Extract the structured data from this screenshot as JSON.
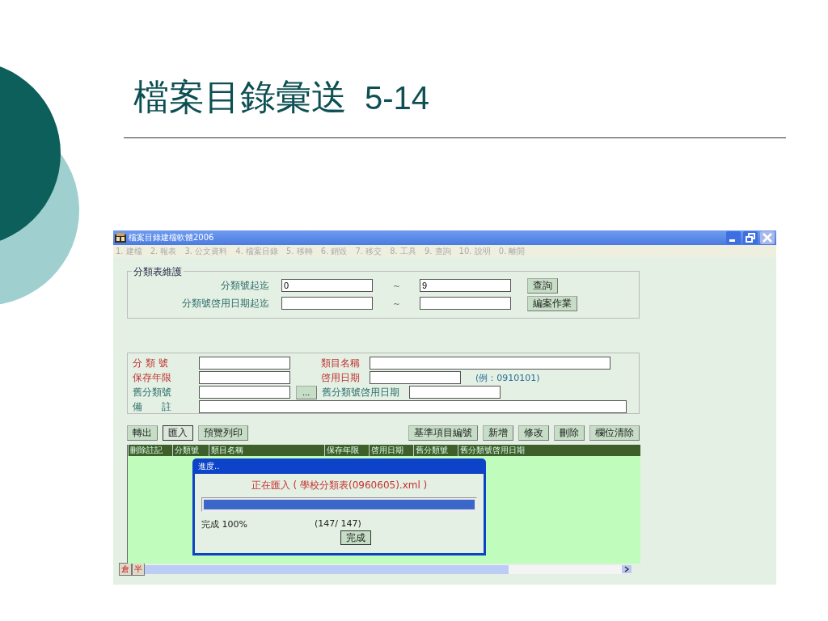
{
  "slide": {
    "title": "檔案目錄彙送",
    "number": "5-14"
  },
  "window": {
    "title": "檔案目錄建檔軟體2006"
  },
  "menu": [
    "1. 建檔",
    "2. 報表",
    "3. 公文資料",
    "4. 檔案目錄",
    "5. 移轉",
    "6. 銷毀",
    "7. 移交",
    "8. 工具",
    "9. 查詢",
    "10. 說明",
    "0. 離開"
  ],
  "range_group": {
    "title": "分類表維護",
    "rows": [
      {
        "label": "分類號起迄",
        "from": "0",
        "separator": "～",
        "to": "9",
        "button": "查詢"
      },
      {
        "label": "分類號啓用日期起迄",
        "separator": "～",
        "button": "編案作業"
      }
    ]
  },
  "form_rows": [
    {
      "cells": [
        {
          "kind": "label",
          "text": "分 類 號",
          "required": true
        },
        {
          "kind": "field"
        },
        {
          "kind": "label",
          "text": "類目名稱",
          "required": true
        },
        {
          "kind": "long_field"
        }
      ]
    },
    {
      "cells": [
        {
          "kind": "label",
          "text": "保存年限",
          "required": true
        },
        {
          "kind": "field"
        },
        {
          "kind": "label",
          "text": "啓用日期",
          "required": true
        },
        {
          "kind": "field"
        },
        {
          "kind": "hint",
          "text": "(例：0910101)"
        }
      ]
    },
    {
      "cells": [
        {
          "kind": "label",
          "text": "舊分類號",
          "required": false
        },
        {
          "kind": "field"
        },
        {
          "kind": "button",
          "text": "..."
        },
        {
          "kind": "label",
          "text": "舊分類號啓用日期",
          "required": false
        },
        {
          "kind": "field"
        }
      ]
    },
    {
      "cells": [
        {
          "kind": "label",
          "text": "備　　註",
          "required": false
        },
        {
          "kind": "long_field"
        }
      ]
    }
  ],
  "left_buttons": [
    {
      "label": "轉出",
      "pressed": false
    },
    {
      "label": "匯入",
      "pressed": true
    },
    {
      "label": "預覽列印",
      "pressed": false
    }
  ],
  "right_buttons": [
    {
      "label": "基準項目編號",
      "pressed": false
    },
    {
      "label": "新增",
      "pressed": false
    },
    {
      "label": "修改",
      "pressed": false
    },
    {
      "label": "刪除",
      "pressed": false
    },
    {
      "label": "欄位清除",
      "pressed": false
    }
  ],
  "table": {
    "columns": [
      "刪除註記",
      "分類號",
      "類目名稱",
      "保存年限",
      "啓用日期",
      "舊分類號",
      "舊分類號啓用日期"
    ]
  },
  "dialog": {
    "title": "進度..",
    "message": "正在匯入 ( 學校分類表(0960605).xml )",
    "level": 1,
    "status": "完成 100%",
    "count": "(147/ 147)",
    "button": "完成"
  },
  "ime": [
    "倉",
    "半"
  ]
}
